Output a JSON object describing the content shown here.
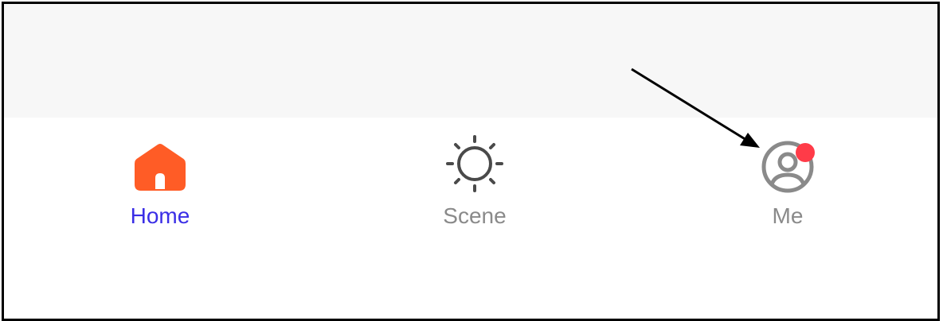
{
  "tabs": [
    {
      "label": "Home",
      "icon": "home-icon",
      "active": true
    },
    {
      "label": "Scene",
      "icon": "sun-icon",
      "active": false
    },
    {
      "label": "Me",
      "icon": "user-profile-icon",
      "active": false,
      "notification_dot": true
    }
  ],
  "colors": {
    "active_label": "#3a2ee6",
    "inactive_label": "#8a8a8a",
    "home_icon": "#ff5c26",
    "scene_icon": "#4a4a4a",
    "me_icon": "#8a8a8a",
    "badge": "#ff3b48",
    "top_area_background": "#f7f7f7",
    "annotation_arrow": "#000000"
  }
}
